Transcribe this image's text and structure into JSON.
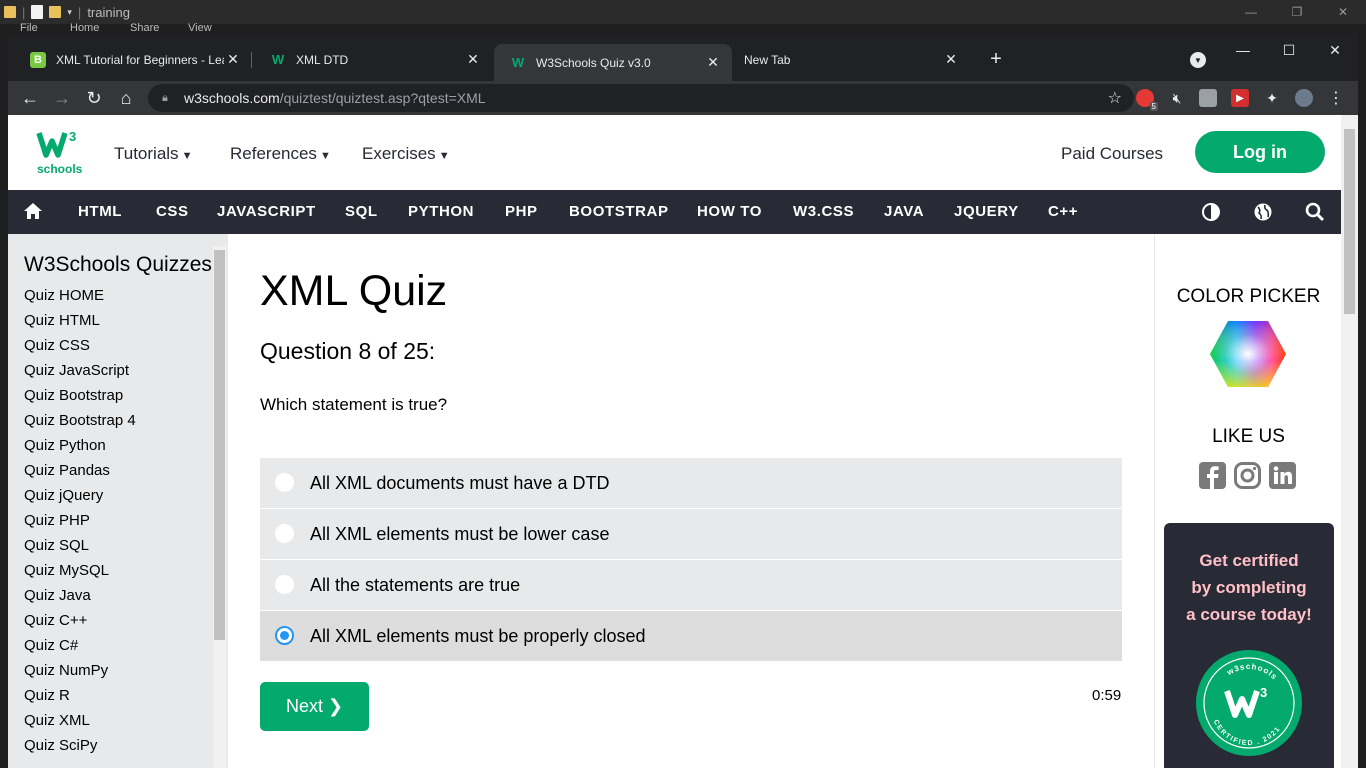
{
  "os": {
    "title": "training",
    "menu": [
      "File",
      "Home",
      "Share",
      "View"
    ]
  },
  "browser": {
    "tabs": [
      {
        "label": "XML Tutorial for Beginners - Lea",
        "favicon": "B",
        "active": false
      },
      {
        "label": "XML DTD",
        "favicon": "W",
        "active": false
      },
      {
        "label": "W3Schools Quiz v3.0",
        "favicon": "W",
        "active": true
      },
      {
        "label": "New Tab",
        "favicon": "",
        "active": false
      }
    ],
    "url_host": "w3schools.com",
    "url_path": "/quiztest/quiztest.asp?qtest=XML",
    "ext_badge": "5"
  },
  "header": {
    "logo_text": "schools",
    "logo_sup": "3",
    "nav": [
      "Tutorials",
      "References",
      "Exercises"
    ],
    "paid_courses": "Paid Courses",
    "login": "Log in"
  },
  "topnav": [
    "HTML",
    "CSS",
    "JAVASCRIPT",
    "SQL",
    "PYTHON",
    "PHP",
    "BOOTSTRAP",
    "HOW TO",
    "W3.CSS",
    "JAVA",
    "JQUERY",
    "C++"
  ],
  "sidebar": {
    "title": "W3Schools Quizzes",
    "links": [
      "Quiz HOME",
      "Quiz HTML",
      "Quiz CSS",
      "Quiz JavaScript",
      "Quiz Bootstrap",
      "Quiz Bootstrap 4",
      "Quiz Python",
      "Quiz Pandas",
      "Quiz jQuery",
      "Quiz PHP",
      "Quiz SQL",
      "Quiz MySQL",
      "Quiz Java",
      "Quiz C++",
      "Quiz C#",
      "Quiz NumPy",
      "Quiz R",
      "Quiz XML",
      "Quiz SciPy"
    ]
  },
  "quiz": {
    "title": "XML Quiz",
    "question_number": "Question 8 of 25:",
    "question": "Which statement is true?",
    "options": [
      {
        "label": "All XML documents must have a DTD",
        "selected": false
      },
      {
        "label": "All XML elements must be lower case",
        "selected": false
      },
      {
        "label": "All the statements are true",
        "selected": false
      },
      {
        "label": "All XML elements must be properly closed",
        "selected": true
      }
    ],
    "next_label": "Next ❯",
    "timer": "0:59"
  },
  "right": {
    "color_picker": "COLOR PICKER",
    "like_us": "LIKE US",
    "cert_lines": [
      "Get certified",
      "by completing",
      "a course today!"
    ],
    "badge_top": "w3schools",
    "badge_bottom": "CERTIFIED . 2021"
  },
  "colors": {
    "brand_green": "#04aa6d",
    "nav_dark": "#282a35",
    "sidebar_bg": "#e7e9eb",
    "cert_pink": "#ffc0c7",
    "radio_blue": "#2196f3"
  }
}
